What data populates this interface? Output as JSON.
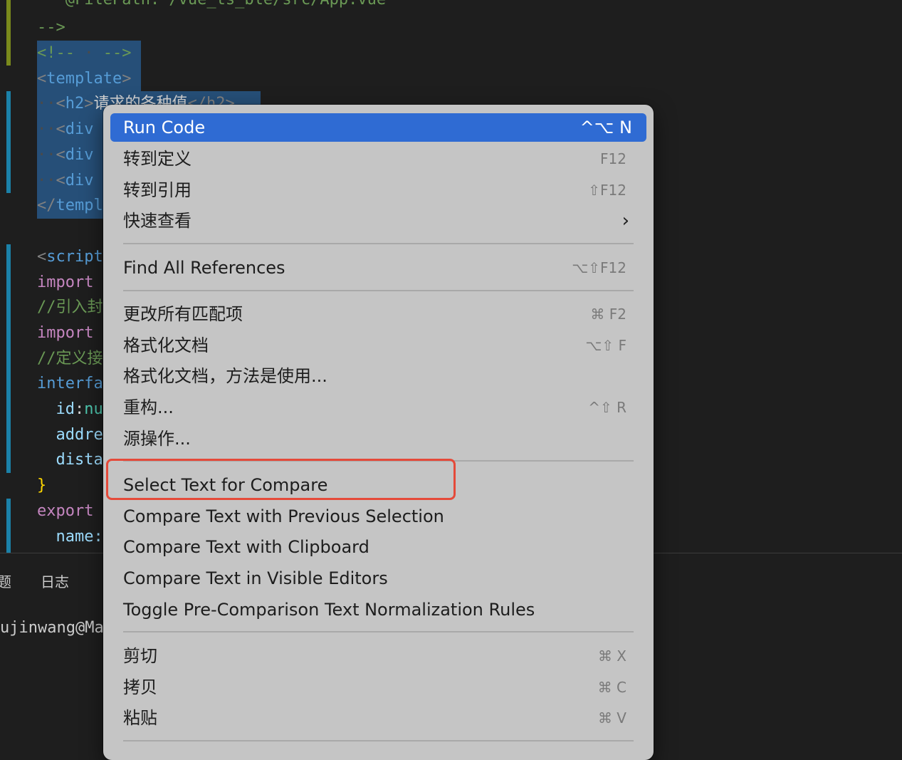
{
  "editor": {
    "lines": {
      "filepath": " * @FilePath: /vue_ts_ble/src/App.vue",
      "comment_close": "-->",
      "empty_comment_open": "<!--",
      "empty_comment_ws": " · ",
      "empty_comment_close": "-->",
      "template_tag": "template",
      "h2_open": "h2",
      "h2_text": "请求的各种值",
      "h2_close": "</h2>",
      "div_tag": "div",
      "template_close": "templ",
      "script_tag": "script",
      "import1": "import",
      "comment1": "//引入封",
      "import2": "import",
      "comment2": "//定义接",
      "interface_kw": "interfa",
      "id_prop": "id",
      "id_type": "nu",
      "address_prop": "addre",
      "distance_prop": "dista",
      "close_brace": "}",
      "export_kw": "export",
      "name_prop": "name:"
    }
  },
  "panel": {
    "tab_problems_partial": "题",
    "tab_log": "日志",
    "terminal_line": "ujinwang@Mac"
  },
  "context_menu": {
    "items": [
      {
        "label": "Run Code",
        "shortcut": "^⌥ N"
      },
      {
        "label": "转到定义",
        "shortcut": "F12"
      },
      {
        "label": "转到引用",
        "shortcut": "⇧F12"
      },
      {
        "label": "快速查看",
        "shortcut": "›"
      },
      {
        "label": "Find All References",
        "shortcut": "⌥⇧F12"
      },
      {
        "label": "更改所有匹配项",
        "shortcut": "⌘ F2"
      },
      {
        "label": "格式化文档",
        "shortcut": "⌥⇧ F"
      },
      {
        "label": "格式化文档，方法是使用...",
        "shortcut": ""
      },
      {
        "label": "重构...",
        "shortcut": "^⇧ R"
      },
      {
        "label": "源操作...",
        "shortcut": ""
      },
      {
        "label": "Select Text for Compare",
        "shortcut": ""
      },
      {
        "label": "Compare Text with Previous Selection",
        "shortcut": ""
      },
      {
        "label": "Compare Text with Clipboard",
        "shortcut": ""
      },
      {
        "label": "Compare Text in Visible Editors",
        "shortcut": ""
      },
      {
        "label": "Toggle Pre-Comparison Text Normalization Rules",
        "shortcut": ""
      },
      {
        "label": "剪切",
        "shortcut": "⌘ X"
      },
      {
        "label": "拷贝",
        "shortcut": "⌘ C"
      },
      {
        "label": "粘贴",
        "shortcut": "⌘ V"
      }
    ]
  },
  "colors": {
    "menu_active": "#2f6bd3",
    "annotation_box": "#e54a3a",
    "editor_bg": "#1e1e1e",
    "selection": "#264f78"
  }
}
